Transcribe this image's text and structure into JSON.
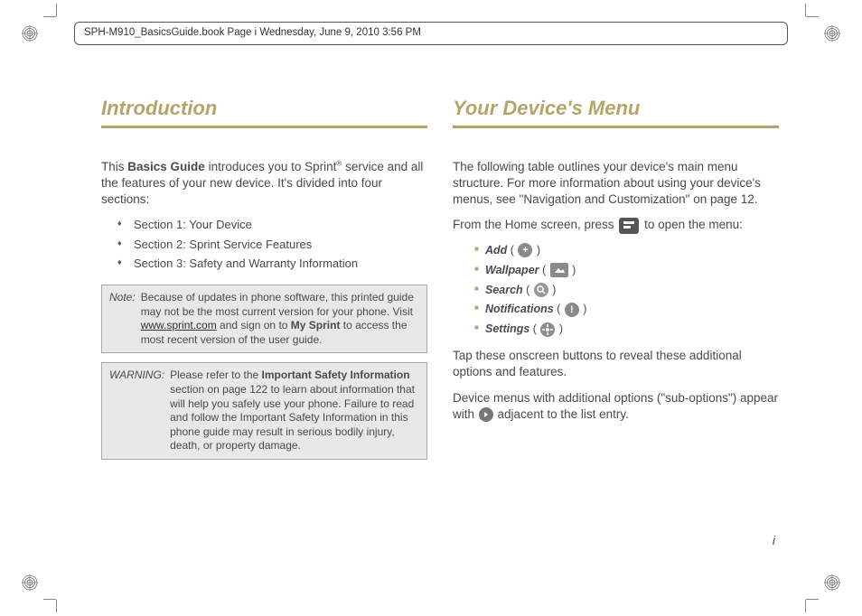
{
  "slug": "SPH-M910_BasicsGuide.book  Page i  Wednesday, June 9, 2010  3:56 PM",
  "left": {
    "heading": "Introduction",
    "intro_pre": "This ",
    "intro_bold": "Basics Guide",
    "intro_post": " introduces you to Sprint",
    "intro_sup": "®",
    "intro_tail": " service and all the features of your new device. It's divided into four sections:",
    "sections": [
      "Section 1:  Your Device",
      "Section 2:  Sprint Service Features",
      "Section 3:  Safety and Warranty Information"
    ],
    "note_label": "Note:",
    "note_pre": "Because of updates in phone software, this printed guide may not be the most current version for your phone. Visit ",
    "note_link": "www.sprint.com",
    "note_mid": " and sign on to ",
    "note_bold": "My Sprint",
    "note_post": " to access the most recent version of the user guide.",
    "warn_label": "WARNING:",
    "warn_pre": "Please refer to the ",
    "warn_bold": "Important Safety Information",
    "warn_post": " section on page 122 to learn about information that will help you safely use your phone. Failure to read and follow the Important Safety Information in this phone guide may result in serious bodily injury, death, or property damage."
  },
  "right": {
    "heading": "Your Device's Menu",
    "p1": "The following table outlines your device's main menu structure. For more information about using your device's menus, see \"Navigation and Customization\" on page 12.",
    "p2_pre": "From the Home screen, press ",
    "p2_post": " to open the menu:",
    "menu": [
      {
        "label": "Add"
      },
      {
        "label": "Wallpaper"
      },
      {
        "label": "Search"
      },
      {
        "label": "Notifications"
      },
      {
        "label": "Settings"
      }
    ],
    "p3": "Tap these onscreen buttons to reveal these additional options and features.",
    "p4_pre": "Device menus with additional options (\"sub-options\") appear with ",
    "p4_post": " adjacent to the list entry."
  },
  "page_number": "i"
}
